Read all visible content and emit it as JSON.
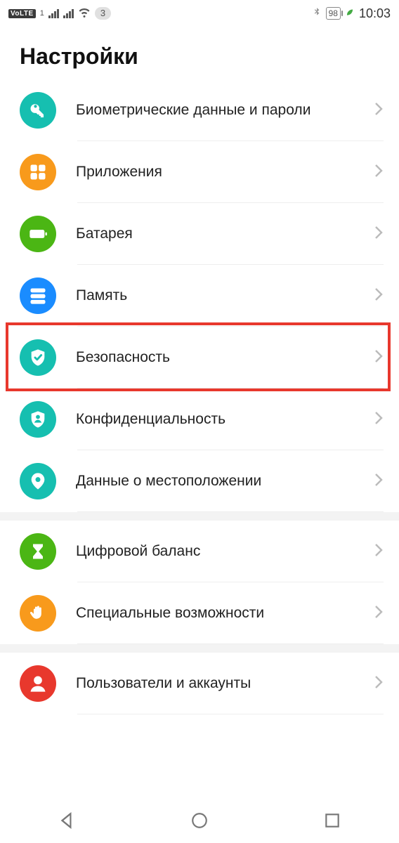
{
  "status": {
    "volte": "VoLTE",
    "sim": "1",
    "notif_count": "3",
    "battery": "98",
    "time": "10:03"
  },
  "title": "Настройки",
  "items": [
    {
      "label": "Биометрические данные и пароли",
      "icon": "key",
      "color": "c-teal"
    },
    {
      "label": "Приложения",
      "icon": "apps",
      "color": "c-orange"
    },
    {
      "label": "Батарея",
      "icon": "battery",
      "color": "c-green"
    },
    {
      "label": "Память",
      "icon": "storage",
      "color": "c-blue"
    },
    {
      "label": "Безопасность",
      "icon": "shield",
      "color": "c-teal",
      "highlighted": true
    },
    {
      "label": "Конфиденциальность",
      "icon": "privacy",
      "color": "c-teal"
    },
    {
      "label": "Данные о местоположении",
      "icon": "location",
      "color": "c-teal",
      "gap_after": true
    },
    {
      "label": "Цифровой баланс",
      "icon": "hourglass",
      "color": "c-green"
    },
    {
      "label": "Специальные возможности",
      "icon": "hand",
      "color": "c-orange",
      "gap_after": true
    },
    {
      "label": "Пользователи и аккаунты",
      "icon": "user",
      "color": "c-red"
    }
  ]
}
